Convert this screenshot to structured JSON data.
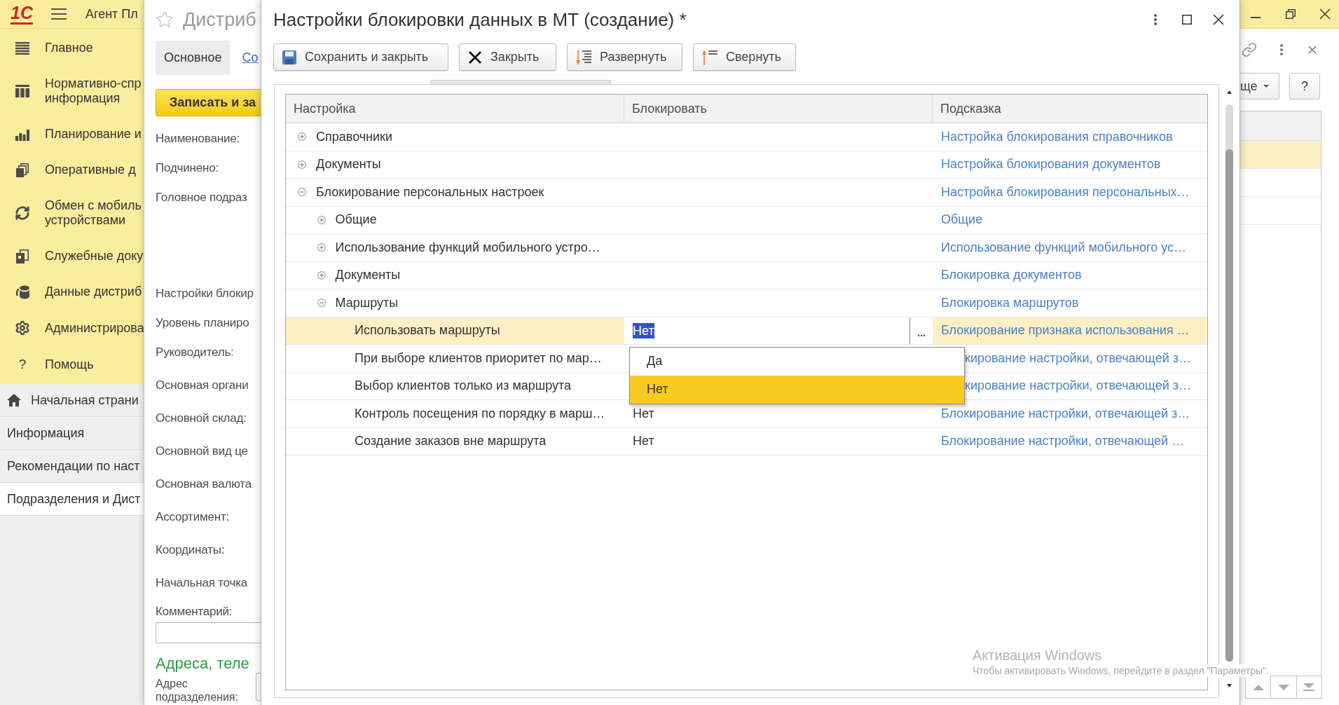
{
  "app": {
    "logo": "1С",
    "title": "Агент Пл"
  },
  "sidebar": {
    "sections": [
      {
        "kind": "main",
        "label": "Главное"
      },
      {
        "kind": "reference",
        "label": "Нормативно-спр\nинформация"
      },
      {
        "kind": "planning",
        "label": "Планирование и"
      },
      {
        "kind": "operations",
        "label": "Оперативные д"
      },
      {
        "kind": "exchange",
        "label": "Обмен с мобиль\nустройствами"
      },
      {
        "kind": "service",
        "label": "Служебные доку"
      },
      {
        "kind": "data",
        "label": "Данные дистриб"
      },
      {
        "kind": "admin",
        "label": "Администрирова"
      },
      {
        "kind": "help",
        "glyph": "?",
        "label": "Помощь"
      }
    ],
    "open_windows": [
      {
        "kind": "home",
        "label": "Начальная страни",
        "selected": false
      },
      {
        "kind": "page",
        "label": "Информация",
        "selected": false
      },
      {
        "kind": "page",
        "label": "Рекомендации по наст",
        "selected": false
      },
      {
        "kind": "page",
        "label": "Подразделения и Дист",
        "selected": true
      }
    ]
  },
  "form": {
    "title": "Дистриб",
    "tabs": [
      {
        "label": "Основное",
        "selected": true
      },
      {
        "label": "Со",
        "selected": false
      }
    ],
    "primary_button": "Записать и за",
    "fields": [
      {
        "label": "Наименование:"
      },
      {
        "label": "Подчинено:"
      },
      {
        "label": "Головное подраз"
      },
      {
        "label": "Настройки блокир"
      },
      {
        "label": "Уровень планиро"
      },
      {
        "label": "Руководитель:"
      },
      {
        "label": "Основная органи"
      },
      {
        "label": "Основной склад:"
      },
      {
        "label": "Основной вид це"
      },
      {
        "label": "Основная валюта"
      },
      {
        "label": "Ассортимент:"
      },
      {
        "label": "Координаты:"
      },
      {
        "label": "Начальная точка"
      }
    ],
    "comment_label": "Комментарий:",
    "section_heading": "Адреса, теле",
    "address_label": "Адрес\nподразделения:"
  },
  "dialog": {
    "title": "Настройки блокировки данных в МТ (создание) *",
    "toolbar": [
      {
        "kind": "save",
        "label": "Сохранить и закрыть"
      },
      {
        "kind": "close",
        "label": "Закрыть"
      },
      {
        "kind": "expand",
        "label": "Развернуть"
      },
      {
        "kind": "collapse",
        "label": "Свернуть"
      }
    ],
    "table": {
      "columns": [
        "Настройка",
        "Блокировать",
        "Подсказка"
      ],
      "rows": [
        {
          "setting": "Справочники",
          "expanded": false,
          "selected": false,
          "hint": "Настройка блокирования справочников"
        },
        {
          "setting": "Документы",
          "expanded": false,
          "selected": false,
          "hint": "Настройка блокирования документов"
        },
        {
          "setting": "Блокирование персональных настроек",
          "expanded": true,
          "selected": false,
          "hint": "Настройка блокирования персональных…",
          "children": [
            {
              "setting": "Общие",
              "expanded": false,
              "selected": false,
              "hint": "Общие"
            },
            {
              "setting": "Использование функций мобильного устро…",
              "expanded": false,
              "selected": false,
              "hint": "Использование функций мобильного ус…"
            },
            {
              "setting": "Документы",
              "expanded": false,
              "selected": false,
              "hint": "Блокировка документов"
            },
            {
              "setting": "Маршруты",
              "expanded": true,
              "selected": false,
              "hint": "Блокировка маршрутов",
              "children": [
                {
                  "setting": "Использовать маршруты",
                  "selected": true,
                  "block": {
                    "value": "Нет",
                    "editing": true,
                    "text_selected": true,
                    "choice_button": "...",
                    "options": [
                      {
                        "label": "Да",
                        "selected": false
                      },
                      {
                        "label": "Нет",
                        "selected": true
                      }
                    ]
                  },
                  "hint": "Блокирование признака использования …"
                },
                {
                  "setting": "При выборе клиентов приоритет по мар…",
                  "selected": false,
                  "hint": "кирование настройки, отвечающей з…"
                },
                {
                  "setting": "Выбор клиентов только из маршрута",
                  "selected": false,
                  "hint": "кирование настройки, отвечающей з…"
                },
                {
                  "setting": "Контроль посещения по порядку в марш…",
                  "selected": false,
                  "block": {
                    "value": "Нет",
                    "editing": false
                  },
                  "hint": "Блокирование настройки, отвечающей з…"
                },
                {
                  "setting": "Создание заказов вне маршрута",
                  "selected": false,
                  "block": {
                    "value": "Нет",
                    "editing": false
                  },
                  "hint": "Блокирование настройки, отвечающей …"
                }
              ]
            }
          ]
        }
      ]
    }
  },
  "right_panel": {
    "more_button": "ще",
    "help_button": "?",
    "list_rows": [
      {
        "selected": true
      },
      {
        "selected": false
      },
      {
        "selected": false
      }
    ]
  },
  "os_notice": {
    "title": "Активация Windows",
    "text": "Чтобы активировать Windows, перейдите в раздел \"Параметры\"."
  }
}
